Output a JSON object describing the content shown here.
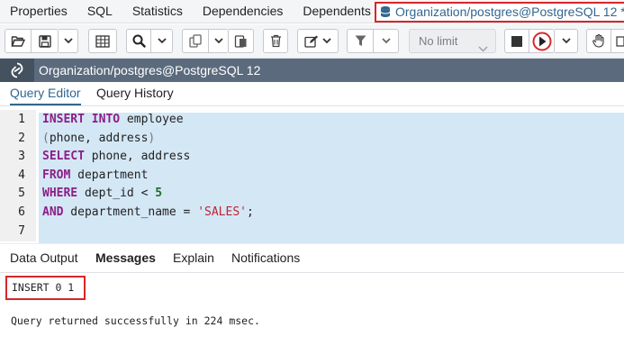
{
  "top_tabs": {
    "items": [
      "Properties",
      "SQL",
      "Statistics",
      "Dependencies",
      "Dependents"
    ],
    "active": "Organization/postgres@PostgreSQL 12 *"
  },
  "toolbar": {
    "limit_value": "No limit",
    "icons": [
      "open-file-icon",
      "save-icon",
      "chevron-down-icon",
      "grid-icon",
      "search-icon",
      "copy-icon",
      "paste-icon",
      "delete-icon",
      "edit-icon",
      "filter-icon",
      "stop-icon",
      "execute-icon",
      "explain-icon"
    ],
    "accent": "#d7262b"
  },
  "titlebar": {
    "title": "Organization/postgres@PostgreSQL 12"
  },
  "editor_tabs": {
    "query_editor": "Query Editor",
    "query_history": "Query History"
  },
  "editor": {
    "line_numbers": [
      "1",
      "2",
      "3",
      "4",
      "5",
      "6",
      "7"
    ],
    "lines": [
      [
        {
          "t": "kw",
          "v": "INSERT"
        },
        {
          "t": "plain",
          "v": " "
        },
        {
          "t": "kw",
          "v": "INTO"
        },
        {
          "t": "plain",
          "v": " employee"
        }
      ],
      [
        {
          "t": "paren",
          "v": "("
        },
        {
          "t": "plain",
          "v": "phone, address"
        },
        {
          "t": "paren",
          "v": ")"
        }
      ],
      [
        {
          "t": "kw",
          "v": "SELECT"
        },
        {
          "t": "plain",
          "v": " phone, address"
        }
      ],
      [
        {
          "t": "kw",
          "v": "FROM"
        },
        {
          "t": "plain",
          "v": " department"
        }
      ],
      [
        {
          "t": "kw",
          "v": "WHERE"
        },
        {
          "t": "plain",
          "v": " dept_id < "
        },
        {
          "t": "num",
          "v": "5"
        }
      ],
      [
        {
          "t": "kw",
          "v": "AND"
        },
        {
          "t": "plain",
          "v": " department_name = "
        },
        {
          "t": "str",
          "v": "'SALES'"
        },
        {
          "t": "plain",
          "v": ";"
        }
      ],
      []
    ]
  },
  "result_tabs": {
    "data_output": "Data Output",
    "messages": "Messages",
    "explain": "Explain",
    "notifications": "Notifications"
  },
  "messages": {
    "result": "INSERT 0 1",
    "status": "Query returned successfully in 224 msec."
  }
}
